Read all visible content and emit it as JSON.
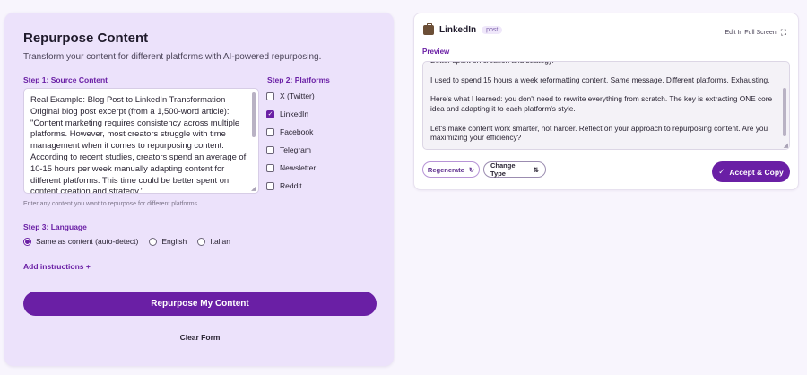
{
  "form": {
    "title": "Repurpose Content",
    "subtitle": "Transform your content for different platforms with AI-powered repurposing.",
    "step1_label": "Step 1: Source Content",
    "source_value": "Real Example: Blog Post to LinkedIn Transformation\nOriginal blog post excerpt (from a 1,500-word article):\n\"Content marketing requires consistency across multiple platforms. However, most creators struggle with time management when it comes to repurposing content. According to recent studies, creators spend an average of 10-15 hours per week manually adapting content for different platforms. This time could be better spent on content creation and strategy.\"",
    "source_helper": "Enter any content you want to repurpose for different platforms",
    "step2_label": "Step 2: Platforms",
    "platforms": [
      {
        "label": "X (Twitter)",
        "checked": false
      },
      {
        "label": "LinkedIn",
        "checked": true
      },
      {
        "label": "Facebook",
        "checked": false
      },
      {
        "label": "Telegram",
        "checked": false
      },
      {
        "label": "Newsletter",
        "checked": false
      },
      {
        "label": "Reddit",
        "checked": false
      }
    ],
    "step3_label": "Step 3: Language",
    "languages": [
      {
        "label": "Same as content (auto-detect)",
        "selected": true
      },
      {
        "label": "English",
        "selected": false
      },
      {
        "label": "Italian",
        "selected": false
      }
    ],
    "add_instructions": "Add instructions +",
    "submit_label": "Repurpose My Content",
    "clear_label": "Clear Form"
  },
  "result": {
    "platform_name": "LinkedIn",
    "badge": "post",
    "fullscreen_label": "Edit In Full Screen",
    "preview_label": "Preview",
    "preview_text": "Better spent on creation and strategy.\n\nI used to spend 15 hours a week reformatting content. Same message. Different platforms. Exhausting.\n\nHere's what I learned: you don't need to rewrite everything from scratch. The key is extracting ONE core idea and adapting it to each platform's style.\n\nLet's make content work smarter, not harder. Reflect on your approach to repurposing content. Are you maximizing your efficiency?",
    "regenerate_label": "Regenerate",
    "change_type_label": "Change Type",
    "accept_label": "Accept & Copy"
  },
  "colors": {
    "accent": "#6a1fa5",
    "panel_bg": "#ece2fb",
    "page_bg": "#f8f5fd"
  },
  "icons": {
    "platform": "briefcase-icon",
    "fullscreen": "expand-icon",
    "regenerate": "refresh-icon",
    "change_type": "sort-arrows-icon",
    "accept": "checkmark-icon"
  }
}
